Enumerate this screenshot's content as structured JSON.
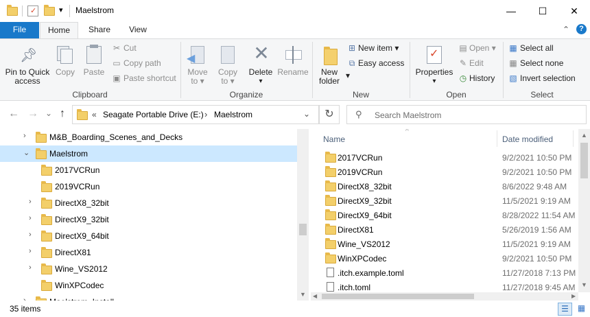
{
  "window": {
    "title": "Maelstrom",
    "minimize": "—",
    "maximize": "☐",
    "close": "✕"
  },
  "qat": {
    "dropdown": "▾"
  },
  "tabs": {
    "file": "File",
    "home": "Home",
    "share": "Share",
    "view": "View"
  },
  "ribbon": {
    "clipboard": {
      "label": "Clipboard",
      "pin": "Pin to Quick access",
      "pin_l1": "Pin to Quick",
      "pin_l2": "access",
      "copy": "Copy",
      "paste": "Paste",
      "cut": "Cut",
      "copy_path": "Copy path",
      "paste_shortcut": "Paste shortcut"
    },
    "organize": {
      "label": "Organize",
      "move_to": "Move to",
      "move_l1": "Move",
      "move_l2": "to ▾",
      "copy_to": "Copy to",
      "copy_l1": "Copy",
      "copy_l2": "to ▾",
      "delete": "Delete",
      "delete_arrow": "▾",
      "rename": "Rename"
    },
    "new": {
      "label": "New",
      "new_folder_l1": "New",
      "new_folder_l2": "folder",
      "new_item": "New item ▾",
      "easy_access": "Easy access ▾"
    },
    "open": {
      "label": "Open",
      "properties": "Properties",
      "properties_arrow": "▾",
      "open": "Open ▾",
      "edit": "Edit",
      "history": "History"
    },
    "select": {
      "label": "Select",
      "select_all": "Select all",
      "select_none": "Select none",
      "invert": "Invert selection"
    }
  },
  "nav": {
    "back": "←",
    "forward": "→",
    "recent": "⌄",
    "up": "↑",
    "address_overflow": "«",
    "crumb_drive": "Seagate Portable Drive (E:)",
    "crumb_sep": "›",
    "crumb_folder": "Maelstrom",
    "address_dropdown": "⌄",
    "refresh": "↻",
    "search_placeholder": "Search Maelstrom"
  },
  "tree": [
    {
      "label": "M&B_Boarding_Scenes_and_Decks",
      "chevron": "›"
    },
    {
      "label": "Maelstrom",
      "chevron": "⌄"
    },
    {
      "label": "2017VCRun",
      "chevron": ""
    },
    {
      "label": "2019VCRun",
      "chevron": ""
    },
    {
      "label": "DirectX8_32bit",
      "chevron": "›"
    },
    {
      "label": "DirectX9_32bit",
      "chevron": "›"
    },
    {
      "label": "DirectX9_64bit",
      "chevron": "›"
    },
    {
      "label": "DirectX81",
      "chevron": "›"
    },
    {
      "label": "Wine_VS2012",
      "chevron": "›"
    },
    {
      "label": "WinXPCodec",
      "chevron": ""
    },
    {
      "label": "Maelstrom_Install",
      "chevron": "›"
    }
  ],
  "list": {
    "col_name": "Name",
    "col_date": "Date modified",
    "sort_arrow": "^",
    "rows": [
      {
        "name": "2017VCRun",
        "date": "9/2/2021 10:50 PM",
        "kind": "folder"
      },
      {
        "name": "2019VCRun",
        "date": "9/2/2021 10:50 PM",
        "kind": "folder"
      },
      {
        "name": "DirectX8_32bit",
        "date": "8/6/2022 9:48 AM",
        "kind": "folder"
      },
      {
        "name": "DirectX9_32bit",
        "date": "11/5/2021 9:19 AM",
        "kind": "folder"
      },
      {
        "name": "DirectX9_64bit",
        "date": "8/28/2022 11:54 AM",
        "kind": "folder"
      },
      {
        "name": "DirectX81",
        "date": "5/26/2019 1:56 AM",
        "kind": "folder"
      },
      {
        "name": "Wine_VS2012",
        "date": "11/5/2021 9:19 AM",
        "kind": "folder"
      },
      {
        "name": "WinXPCodec",
        "date": "9/2/2021 10:50 PM",
        "kind": "folder"
      },
      {
        "name": ".itch.example.toml",
        "date": "11/27/2018 7:13 PM",
        "kind": "file"
      },
      {
        "name": ".itch.toml",
        "date": "11/27/2018 9:45 AM",
        "kind": "file"
      }
    ]
  },
  "status": {
    "count": "35 items"
  },
  "colors": {
    "accent": "#1979ca",
    "selection": "#cce8ff",
    "folder": "#f3cf6a"
  }
}
